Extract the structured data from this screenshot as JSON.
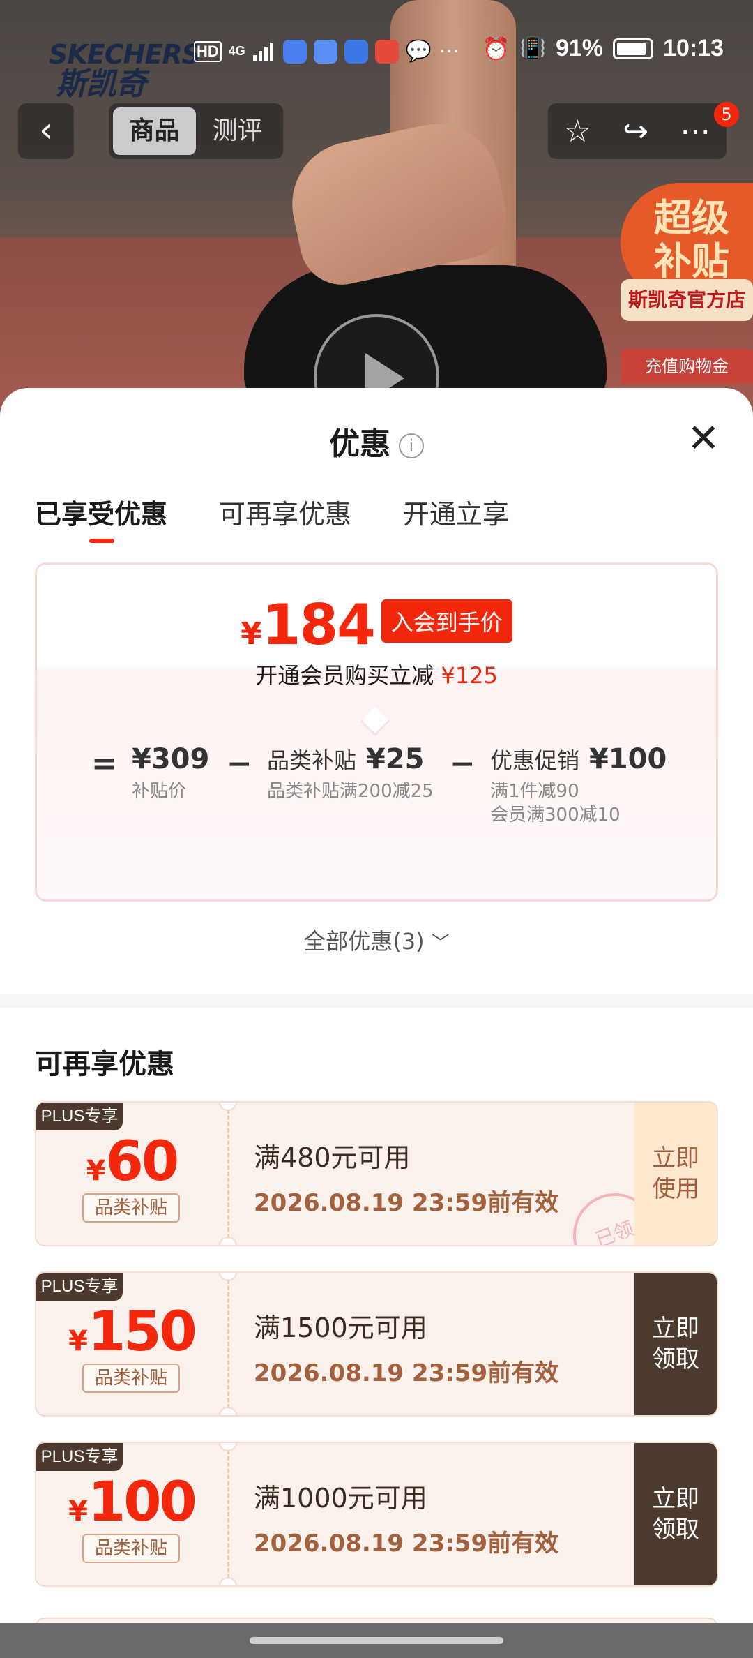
{
  "hero": {
    "brand_en": "SKECHERS",
    "brand_zh": "斯凯奇",
    "promo_badge": "超级\n补贴",
    "promo_tag": "斯凯奇官方店",
    "promo_sub": "充值购物金"
  },
  "status_bar": {
    "battery": "91%",
    "time": "10:13",
    "network": "4G"
  },
  "nav": {
    "back": "‹",
    "tabs": [
      "商品",
      "测评"
    ],
    "active_tab": 0,
    "badge_count": "5"
  },
  "sheet": {
    "title": "优惠",
    "close": "✕",
    "tabs": [
      "已享受优惠",
      "可再享优惠",
      "开通立享"
    ],
    "active_tab": 0,
    "final_price": {
      "currency": "¥",
      "amount": "184",
      "tag": "入会到手价"
    },
    "member_line": {
      "text": "开通会员购买立减",
      "amount": "¥125"
    },
    "breakdown": {
      "equals": "=",
      "minus": "−",
      "items": [
        {
          "main": "¥309",
          "label": "",
          "sub": "补贴价"
        },
        {
          "main": "¥25",
          "label": "品类补贴",
          "sub": "品类补贴满200减25"
        },
        {
          "main": "¥100",
          "label": "优惠促销",
          "sub": "满1件减90\n会员满300减10"
        }
      ]
    },
    "all_offers": "全部优惠(3)",
    "section_title": "可再享优惠",
    "coupons": [
      {
        "badge": "PLUS专享",
        "currency": "¥",
        "amount": "60",
        "type": "品类补贴",
        "condition": "满480元可用",
        "validity": "2026.08.19 23:59前有效",
        "button": "立即\n使用",
        "button_style": "used",
        "stamp": "已领"
      },
      {
        "badge": "PLUS专享",
        "currency": "¥",
        "amount": "150",
        "type": "品类补贴",
        "condition": "满1500元可用",
        "validity": "2026.08.19 23:59前有效",
        "button": "立即\n领取",
        "button_style": "get"
      },
      {
        "badge": "PLUS专享",
        "currency": "¥",
        "amount": "100",
        "type": "品类补贴",
        "condition": "满1000元可用",
        "validity": "2026.08.19 23:59前有效",
        "button": "立即\n领取",
        "button_style": "get"
      }
    ]
  },
  "colors": {
    "accent_red": "#f2270c",
    "coupon_brown": "#4c3a2f",
    "coupon_bg": "#fbf1ec",
    "coupon_gold": "#a2603d"
  }
}
